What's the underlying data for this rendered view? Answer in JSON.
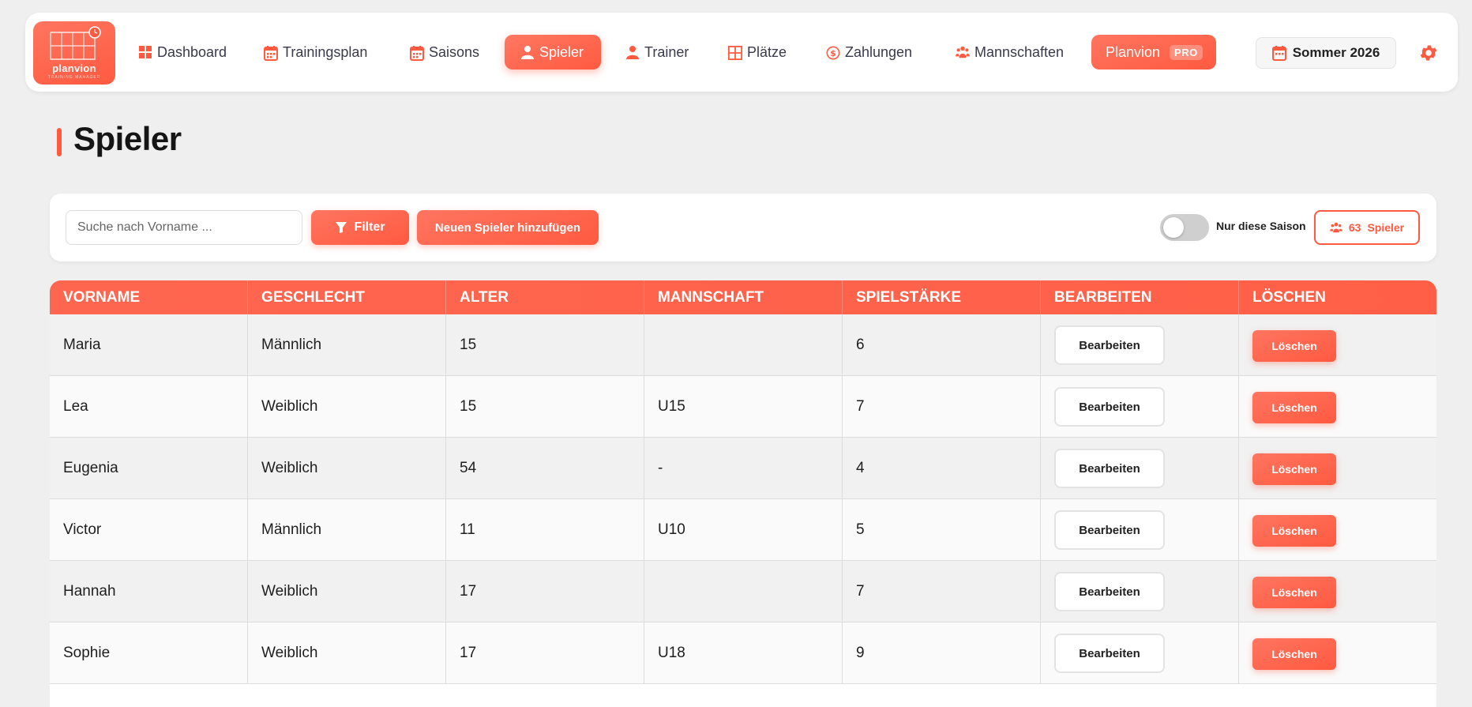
{
  "brand": {
    "name": "planvion",
    "tagline": "TRAINING MANAGER"
  },
  "nav": {
    "items": [
      {
        "label": "Dashboard",
        "icon": "grid-icon"
      },
      {
        "label": "Trainingsplan",
        "icon": "calendar-icon"
      },
      {
        "label": "Saisons",
        "icon": "calendar-icon"
      },
      {
        "label": "Spieler",
        "icon": "user-icon",
        "active": true
      },
      {
        "label": "Trainer",
        "icon": "user-icon"
      },
      {
        "label": "Plätze",
        "icon": "court-icon"
      },
      {
        "label": "Zahlungen",
        "icon": "dollar-icon"
      },
      {
        "label": "Mannschaften",
        "icon": "team-icon"
      }
    ],
    "pro": {
      "label": "Planvion",
      "badge": "PRO"
    },
    "season": "Sommer 2026"
  },
  "page": {
    "title": "Spieler"
  },
  "toolbar": {
    "search_placeholder": "Suche nach Vorname ...",
    "filter_label": "Filter",
    "add_label": "Neuen Spieler hinzufügen",
    "toggle_label": "Nur diese Saison",
    "toggle_on": false,
    "count": "63",
    "count_label": "Spieler"
  },
  "table": {
    "headers": [
      "VORNAME",
      "GESCHLECHT",
      "ALTER",
      "MANNSCHAFT",
      "SPIELSTÄRKE",
      "BEARBEITEN",
      "LÖSCHEN"
    ],
    "edit_label": "Bearbeiten",
    "delete_label": "Löschen",
    "rows": [
      {
        "vorname": "Maria",
        "geschlecht": "Männlich",
        "alter": "15",
        "mannschaft": "",
        "spielstaerke": "6"
      },
      {
        "vorname": "Lea",
        "geschlecht": "Weiblich",
        "alter": "15",
        "mannschaft": "U15",
        "spielstaerke": "7"
      },
      {
        "vorname": "Eugenia",
        "geschlecht": "Weiblich",
        "alter": "54",
        "mannschaft": "-",
        "spielstaerke": "4"
      },
      {
        "vorname": "Victor",
        "geschlecht": "Männlich",
        "alter": "11",
        "mannschaft": "U10",
        "spielstaerke": "5"
      },
      {
        "vorname": "Hannah",
        "geschlecht": "Weiblich",
        "alter": "17",
        "mannschaft": "",
        "spielstaerke": "7"
      },
      {
        "vorname": "Sophie",
        "geschlecht": "Weiblich",
        "alter": "17",
        "mannschaft": "U18",
        "spielstaerke": "9"
      }
    ]
  },
  "colors": {
    "accent": "#ff5a40",
    "background": "#efefef"
  }
}
